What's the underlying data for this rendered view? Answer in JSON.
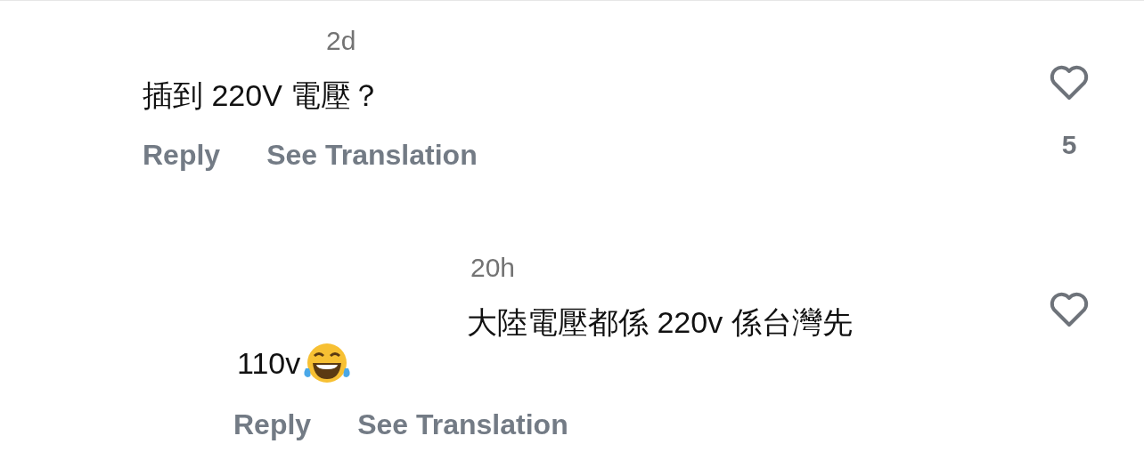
{
  "comments": [
    {
      "time": "2d",
      "lines": [
        {
          "text": "插到 220V 電壓？",
          "emoji": false
        }
      ],
      "actions": [
        "Reply",
        "See Translation"
      ],
      "liked": false,
      "likes": "5",
      "reply": false
    },
    {
      "time": "20h",
      "lines": [
        {
          "text": "大陸電壓都係 220v 係台灣先",
          "emoji": false
        },
        {
          "text": "110v",
          "emoji": true
        }
      ],
      "actions": [
        "Reply",
        "See Translation"
      ],
      "liked": false,
      "reply": true
    }
  ]
}
